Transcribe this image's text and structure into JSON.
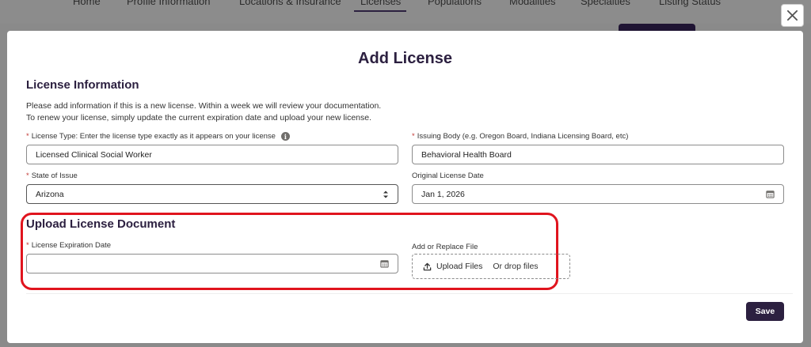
{
  "background": {
    "nav_items": [
      "Home",
      "Profile Information",
      "Locations & Insurance",
      "Licenses",
      "Populations",
      "Modalities",
      "Specialties",
      "Listing Status"
    ]
  },
  "modal": {
    "title": "Add License",
    "section1": {
      "title": "License Information",
      "description_line1": "Please add information if this is a new license. Within a week we will review your documentation.",
      "description_line2": "To renew your license, simply update the current expiration date and upload your new license."
    },
    "license_type": {
      "label": "License Type: Enter the license type exactly as it appears on your license",
      "value": "Licensed Clinical Social Worker"
    },
    "issuing_body": {
      "label": "Issuing Body (e.g. Oregon Board, Indiana Licensing Board, etc)",
      "value": "Behavioral Health Board"
    },
    "state_of_issue": {
      "label": "State of Issue",
      "value": "Arizona"
    },
    "original_license_date": {
      "label": "Original License Date",
      "value": "Jan 1, 2026"
    },
    "section2": {
      "title": "Upload License Document"
    },
    "expiration_date": {
      "label": "License Expiration Date",
      "value": ""
    },
    "file_upload": {
      "label": "Add or Replace File",
      "button_label": "Upload Files",
      "drop_text": "Or drop files"
    },
    "save_label": "Save",
    "required_marker": "*"
  },
  "colors": {
    "brand": "#2c2040",
    "highlight": "#e0141e",
    "required": "#c23934"
  }
}
